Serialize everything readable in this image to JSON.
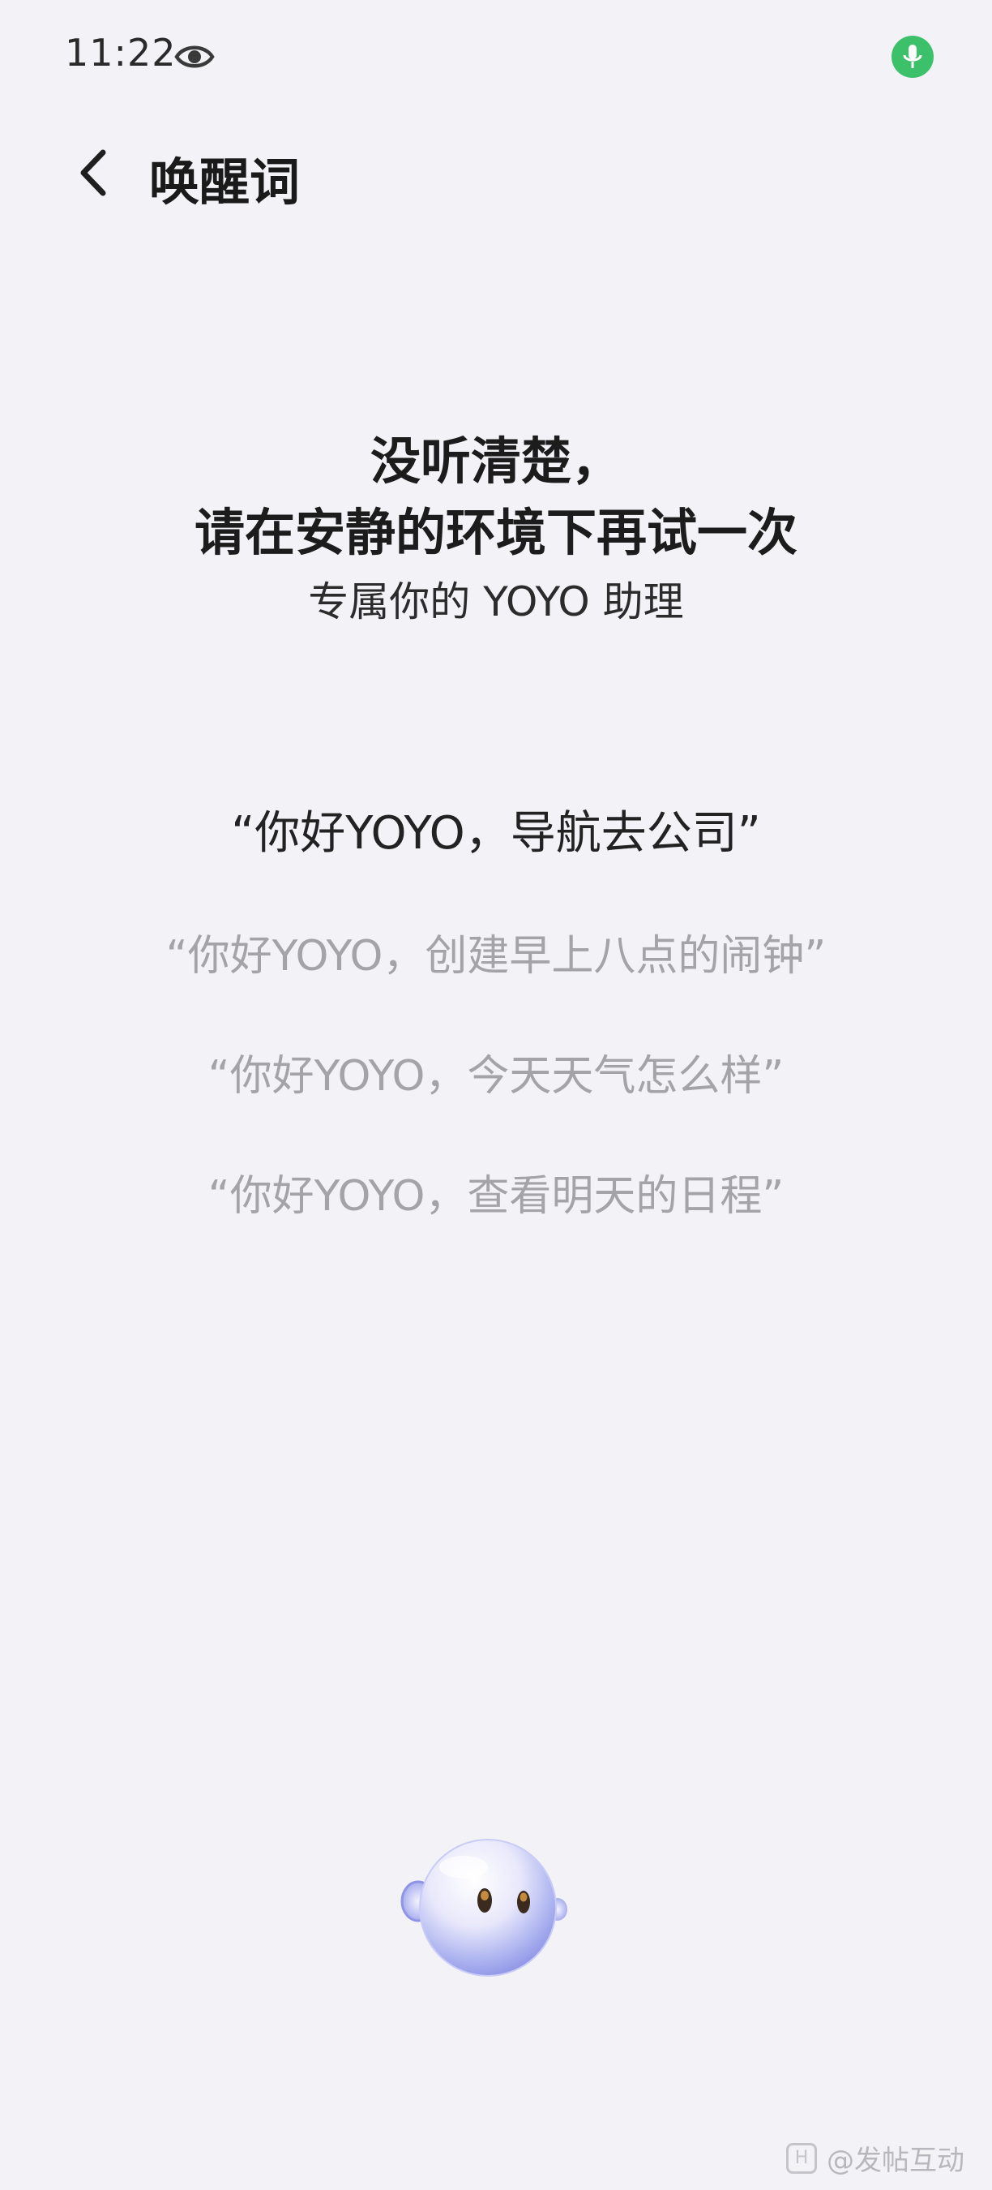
{
  "status_bar": {
    "time": "11:22",
    "icons": [
      "eye-icon",
      "mic-icon"
    ],
    "mic_color": "#3cc16a"
  },
  "header": {
    "title": "唤醒词"
  },
  "main": {
    "headline_line1": "没听清楚，",
    "headline_line2": "请在安静的环境下再试一次",
    "subtitle": "专属你的 YOYO 助理",
    "phrases": [
      "“你好YOYO，导航去公司”",
      "“你好YOYO，创建早上八点的闹钟”",
      "“你好YOYO，今天天气怎么样”",
      "“你好YOYO，查看明天的日程”"
    ]
  },
  "watermark": {
    "badge": "H",
    "text": "@发帖互动"
  },
  "colors": {
    "background": "#f2f2f7",
    "dim_text": "#a4a4a8",
    "accent_green": "#3cc16a"
  }
}
